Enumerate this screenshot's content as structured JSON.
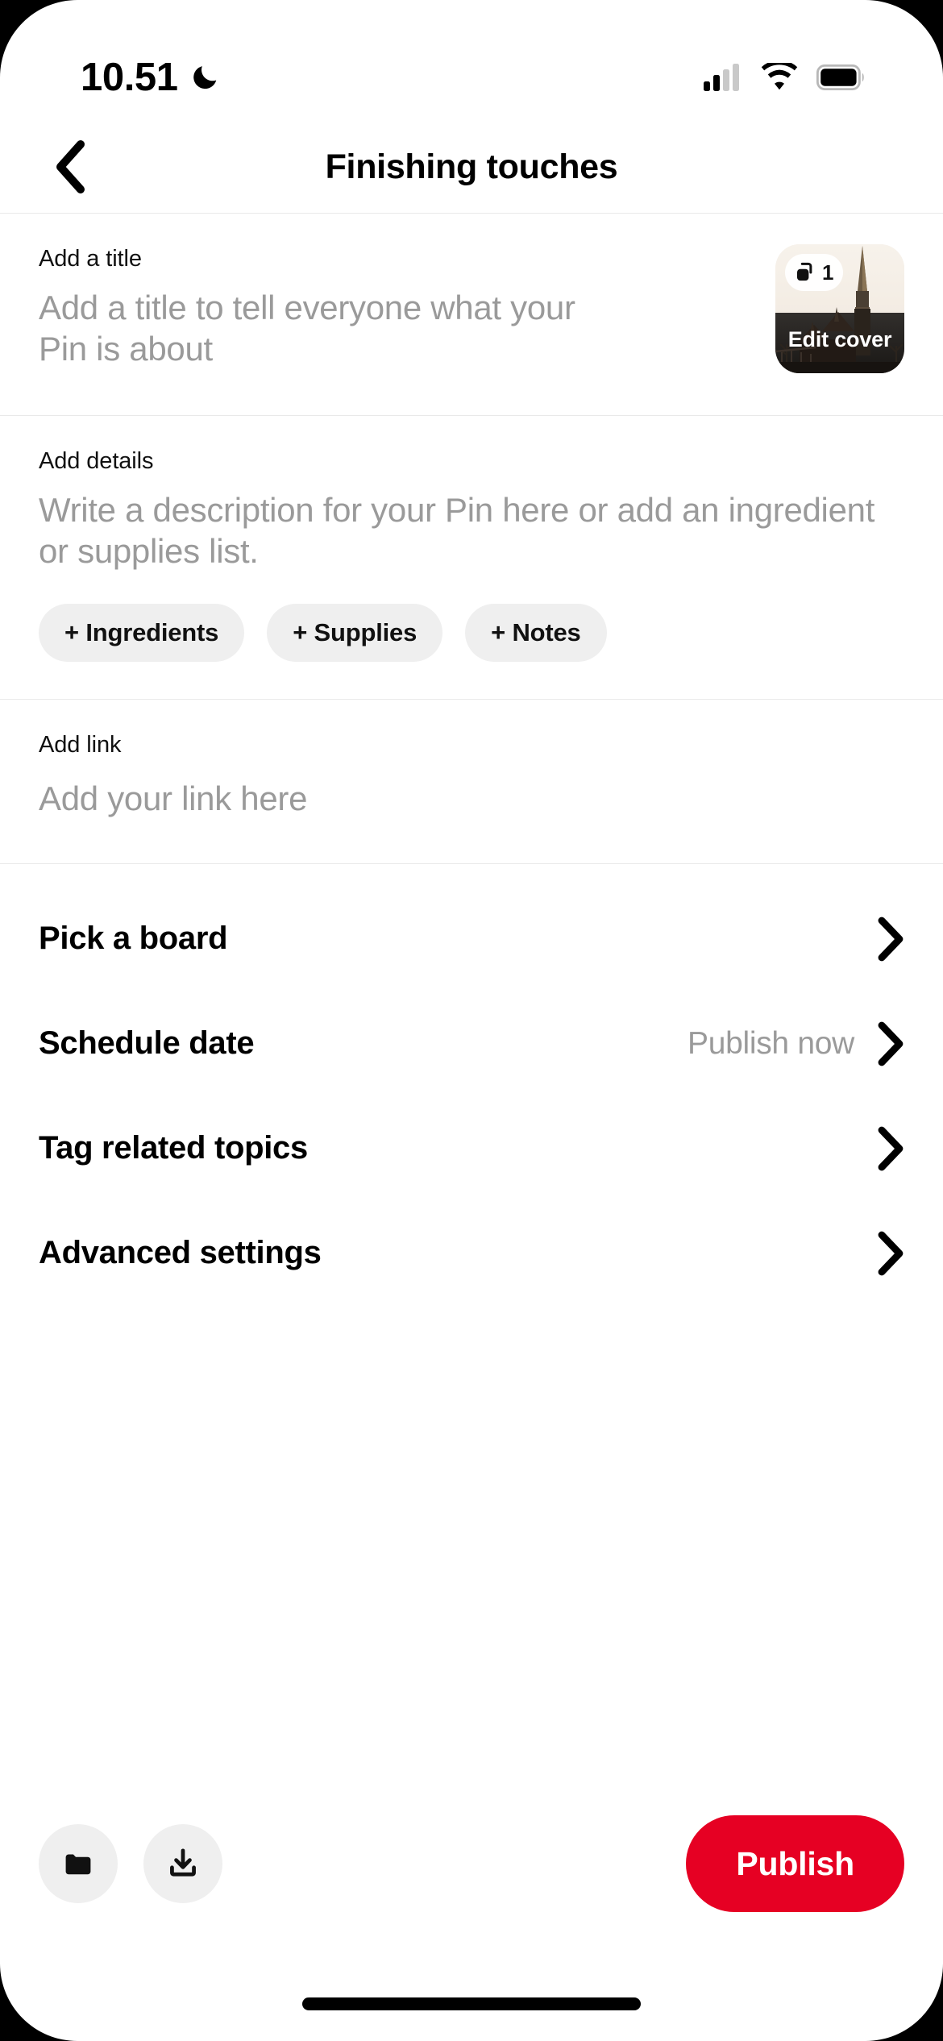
{
  "status_bar": {
    "time": "10.51",
    "dnd_icon": "crescent-moon-icon",
    "signal_icon": "cellular-signal-icon",
    "wifi_icon": "wifi-icon",
    "battery_icon": "battery-full-icon"
  },
  "header": {
    "back_icon": "chevron-left-icon",
    "title": "Finishing touches"
  },
  "title_section": {
    "label": "Add a title",
    "placeholder": "Add a title to tell everyone what your Pin is about",
    "value": "",
    "cover": {
      "pages_icon": "pages-stack-icon",
      "pages_count": "1",
      "edit_label": "Edit cover"
    }
  },
  "details_section": {
    "label": "Add details",
    "placeholder": "Write a description for your Pin here or add an ingredient or supplies list.",
    "value": "",
    "chips": [
      {
        "label": "+ Ingredients"
      },
      {
        "label": "+ Supplies"
      },
      {
        "label": "+ Notes"
      }
    ]
  },
  "link_section": {
    "label": "Add link",
    "placeholder": "Add your link here",
    "value": ""
  },
  "nav_rows": [
    {
      "label": "Pick a board",
      "value": "",
      "chevron": "chevron-right-icon"
    },
    {
      "label": "Schedule date",
      "value": "Publish now",
      "chevron": "chevron-right-icon"
    },
    {
      "label": "Tag related topics",
      "value": "",
      "chevron": "chevron-right-icon"
    },
    {
      "label": "Advanced settings",
      "value": "",
      "chevron": "chevron-right-icon"
    }
  ],
  "bottom_bar": {
    "folder_icon": "folder-icon",
    "download_icon": "download-icon",
    "publish_label": "Publish"
  },
  "colors": {
    "brand_red": "#e60023",
    "chip_gray": "#efefef",
    "placeholder_gray": "#9a9a9a",
    "divider": "#e9e9e9",
    "text_primary": "#000000"
  }
}
